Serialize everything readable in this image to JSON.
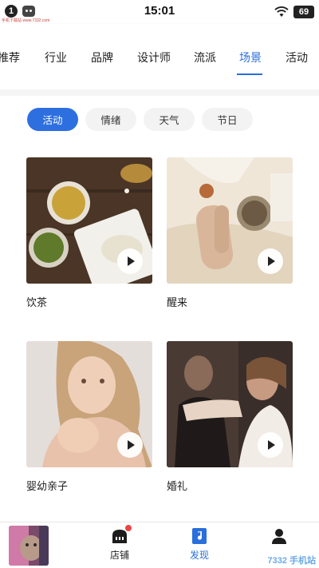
{
  "status_bar": {
    "notification_count": "1",
    "watermark": "手机下载站 www.7332.com",
    "time": "15:01",
    "battery": "69"
  },
  "tabs": [
    {
      "label": "推荐",
      "active": false
    },
    {
      "label": "行业",
      "active": false
    },
    {
      "label": "品牌",
      "active": false
    },
    {
      "label": "设计师",
      "active": false
    },
    {
      "label": "流派",
      "active": false
    },
    {
      "label": "场景",
      "active": true
    },
    {
      "label": "活动",
      "active": false
    }
  ],
  "filters": [
    {
      "label": "活动",
      "active": true
    },
    {
      "label": "情绪",
      "active": false
    },
    {
      "label": "天气",
      "active": false
    },
    {
      "label": "节日",
      "active": false
    }
  ],
  "cards": [
    {
      "title": "饮茶"
    },
    {
      "title": "醒来"
    },
    {
      "title": "婴幼亲子"
    },
    {
      "title": "婚礼"
    }
  ],
  "bottom_nav": {
    "items": [
      {
        "label": "店铺",
        "active": false
      },
      {
        "label": "发现",
        "active": true
      }
    ],
    "corner_watermark": "7332 手机站"
  },
  "colors": {
    "accent": "#2a6fdb",
    "chip_active": "#2e6fe0",
    "badge": "#e84545"
  }
}
